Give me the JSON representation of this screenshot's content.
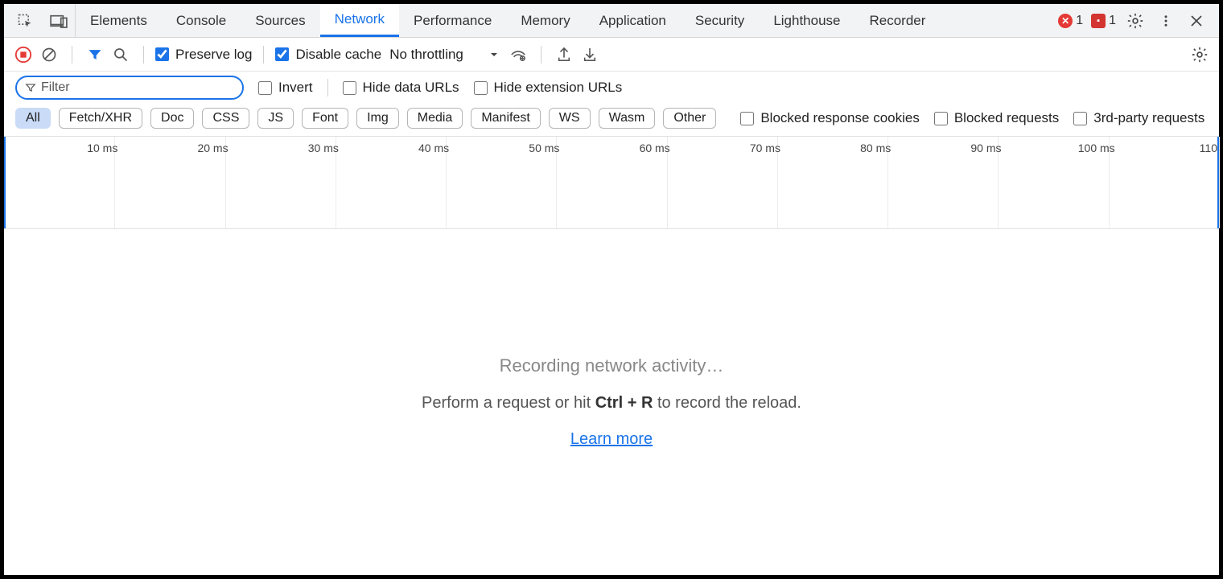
{
  "tabs": {
    "items": [
      "Elements",
      "Console",
      "Sources",
      "Network",
      "Performance",
      "Memory",
      "Application",
      "Security",
      "Lighthouse",
      "Recorder"
    ],
    "active_index": 3
  },
  "header": {
    "errors_count": "1",
    "issues_count": "1"
  },
  "toolbar": {
    "preserve_log_label": "Preserve log",
    "preserve_log_checked": true,
    "disable_cache_label": "Disable cache",
    "disable_cache_checked": true,
    "throttling_label": "No throttling"
  },
  "filter": {
    "placeholder": "Filter",
    "value": "",
    "invert_label": "Invert",
    "invert_checked": false,
    "hide_data_urls_label": "Hide data URLs",
    "hide_data_urls_checked": false,
    "hide_ext_urls_label": "Hide extension URLs",
    "hide_ext_urls_checked": false
  },
  "type_filters": {
    "items": [
      "All",
      "Fetch/XHR",
      "Doc",
      "CSS",
      "JS",
      "Font",
      "Img",
      "Media",
      "Manifest",
      "WS",
      "Wasm",
      "Other"
    ],
    "active_index": 0,
    "blocked_cookies_label": "Blocked response cookies",
    "blocked_requests_label": "Blocked requests",
    "third_party_label": "3rd-party requests"
  },
  "timeline": {
    "ticks": [
      "10 ms",
      "20 ms",
      "30 ms",
      "40 ms",
      "50 ms",
      "60 ms",
      "70 ms",
      "80 ms",
      "90 ms",
      "100 ms",
      "110"
    ]
  },
  "empty_state": {
    "title": "Recording network activity…",
    "hint_prefix": "Perform a request or hit ",
    "hint_shortcut": "Ctrl + R",
    "hint_suffix": " to record the reload.",
    "learn_more": "Learn more"
  }
}
